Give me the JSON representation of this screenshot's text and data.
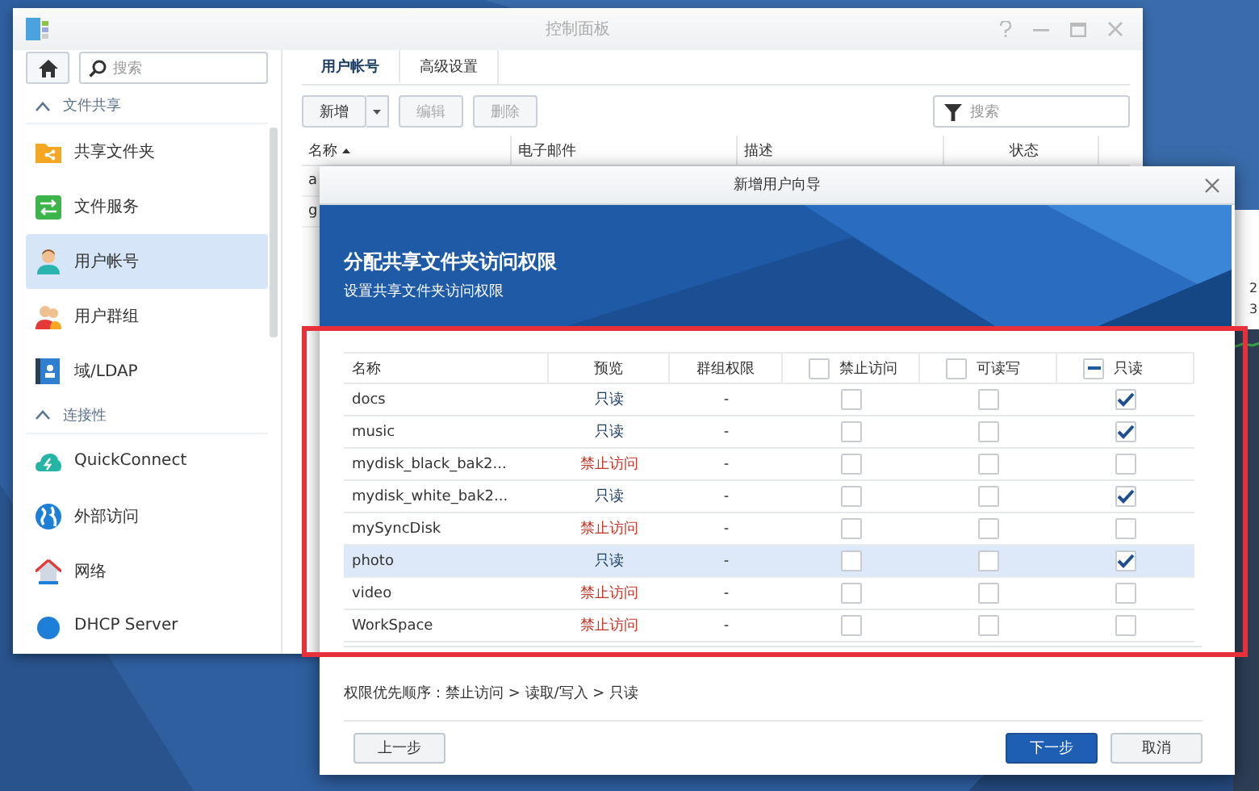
{
  "back_window": {
    "title": "控制面板",
    "search": {
      "placeholder": "搜索"
    },
    "sidebar": [
      {
        "kind": "header",
        "label": "文件共享",
        "expanded": true
      },
      {
        "kind": "item",
        "label": "共享文件夹",
        "selected": false
      },
      {
        "kind": "item",
        "label": "文件服务",
        "selected": false
      },
      {
        "kind": "item",
        "label": "用户帐号",
        "selected": true
      },
      {
        "kind": "item",
        "label": "用户群组",
        "selected": false
      },
      {
        "kind": "item",
        "label": "域/LDAP",
        "selected": false
      },
      {
        "kind": "header",
        "label": "连接性",
        "expanded": true
      },
      {
        "kind": "item",
        "label": "QuickConnect",
        "selected": false
      },
      {
        "kind": "item",
        "label": "外部访问",
        "selected": false
      },
      {
        "kind": "item",
        "label": "网络",
        "selected": false
      },
      {
        "kind": "item",
        "label": "DHCP Server",
        "selected": false
      }
    ],
    "tabs": [
      {
        "label": "用户帐号",
        "selected": true
      },
      {
        "label": "高级设置",
        "selected": false
      }
    ],
    "toolbar": [
      {
        "label": "新增",
        "disabled": false,
        "dropdown": true
      },
      {
        "label": "编辑",
        "disabled": true,
        "dropdown": false
      },
      {
        "label": "删除",
        "disabled": true,
        "dropdown": false
      }
    ],
    "filter": {
      "placeholder": "搜索"
    },
    "columns": [
      {
        "label": "名称",
        "sorted": true
      },
      {
        "label": "电子邮件",
        "sorted": false
      },
      {
        "label": "描述",
        "sorted": false
      },
      {
        "label": "状态",
        "sorted": false
      }
    ],
    "rows": [
      "a",
      "g"
    ]
  },
  "side_widget": {
    "values": [
      "2",
      "3"
    ]
  },
  "wizard": {
    "title": "新增用户向导",
    "heading": "分配共享文件夹访问权限",
    "subheading": "设置共享文件夹访问权限",
    "columns": [
      {
        "label": "名称",
        "kind": "text"
      },
      {
        "label": "预览",
        "kind": "text"
      },
      {
        "label": "群组权限",
        "kind": "text"
      },
      {
        "label": "禁止访问",
        "kind": "check",
        "partial": false
      },
      {
        "label": "可读写",
        "kind": "check",
        "partial": false
      },
      {
        "label": "只读",
        "kind": "check",
        "partial": true
      }
    ],
    "rows": [
      {
        "name": "docs",
        "preview": "只读",
        "denied": false,
        "group": "-",
        "deny": false,
        "read_write": false,
        "read_only": true,
        "selected": false
      },
      {
        "name": "music",
        "preview": "只读",
        "denied": false,
        "group": "-",
        "deny": false,
        "read_write": false,
        "read_only": true,
        "selected": false
      },
      {
        "name": "mydisk_black_bak2...",
        "preview": "禁止访问",
        "denied": true,
        "group": "-",
        "deny": false,
        "read_write": false,
        "read_only": false,
        "selected": false
      },
      {
        "name": "mydisk_white_bak2...",
        "preview": "只读",
        "denied": false,
        "group": "-",
        "deny": false,
        "read_write": false,
        "read_only": true,
        "selected": false
      },
      {
        "name": "mySyncDisk",
        "preview": "禁止访问",
        "denied": true,
        "group": "-",
        "deny": false,
        "read_write": false,
        "read_only": false,
        "selected": false
      },
      {
        "name": "photo",
        "preview": "只读",
        "denied": false,
        "group": "-",
        "deny": false,
        "read_write": false,
        "read_only": true,
        "selected": true
      },
      {
        "name": "video",
        "preview": "禁止访问",
        "denied": true,
        "group": "-",
        "deny": false,
        "read_write": false,
        "read_only": false,
        "selected": false
      },
      {
        "name": "WorkSpace",
        "preview": "禁止访问",
        "denied": true,
        "group": "-",
        "deny": false,
        "read_write": false,
        "read_only": false,
        "selected": false
      }
    ],
    "note": "权限优先顺序：禁止访问 > 读取/写入 > 只读",
    "buttons": [
      {
        "label": "上一步",
        "kind": "plain"
      },
      {
        "label": "下一步",
        "kind": "primary"
      },
      {
        "label": "取消",
        "kind": "plain"
      }
    ]
  }
}
